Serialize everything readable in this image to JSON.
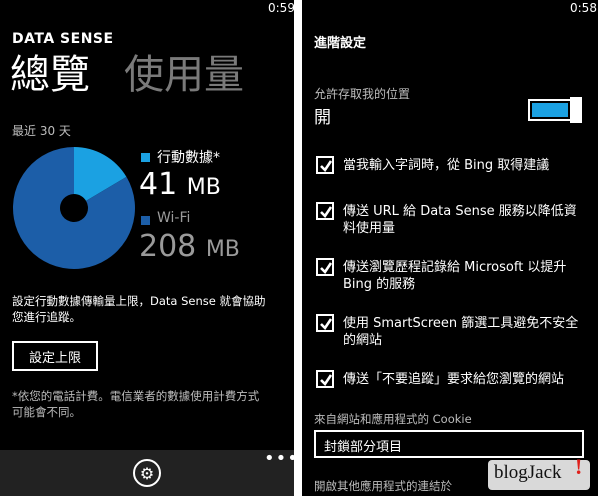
{
  "left": {
    "clock": "0:59",
    "app_title": "DATA SENSE",
    "pivot_active": "總覽",
    "pivot_inactive": "使用量",
    "period_label": "最近 30 天",
    "chart_data": {
      "type": "pie",
      "categories": [
        "行動數據*",
        "Wi-Fi"
      ],
      "values": [
        41,
        208
      ],
      "units": "MB",
      "colors": [
        "#1ba1e2",
        "#1c5ea8"
      ]
    },
    "legend": {
      "cellular_label": "行動數據*",
      "cellular_value": "41",
      "cellular_unit": "MB",
      "wifi_label": "Wi-Fi",
      "wifi_value": "208",
      "wifi_unit": "MB"
    },
    "description_line1": "設定行動數據傳輸量上限，Data Sense 就會協助",
    "description_line2": "您進行追蹤。",
    "set_limit_button": "設定上限",
    "footnote_line1": "*依您的電話計費。電信業者的數據使用計費方式",
    "footnote_line2": "可能會不同。",
    "settings_icon": "gear-icon",
    "more_icon": "ellipsis-icon",
    "accent_color": "#1ba1e2"
  },
  "right": {
    "clock": "0:58",
    "page_title": "進階設定",
    "location_label": "允許存取我的位置",
    "location_state": "開",
    "options": [
      {
        "line1": "當我輸入字詞時，從 Bing 取得建議",
        "line2": ""
      },
      {
        "line1": "傳送 URL 給 Data Sense 服務以降低資",
        "line2": "料使用量"
      },
      {
        "line1": "傳送瀏覽歷程記錄給 Microsoft 以提升",
        "line2": "Bing 的服務"
      },
      {
        "line1": "使用 SmartScreen 篩選工具避免不安全",
        "line2": "的網站"
      },
      {
        "line1": "傳送「不要追蹤」要求給您瀏覽的網站",
        "line2": ""
      }
    ],
    "cookie_label": "來自網站和應用程式的 Cookie",
    "cookie_selected": "封鎖部分項目",
    "bottom_label": "開啟其他應用程式的連結於",
    "watermark": "blogJack"
  }
}
